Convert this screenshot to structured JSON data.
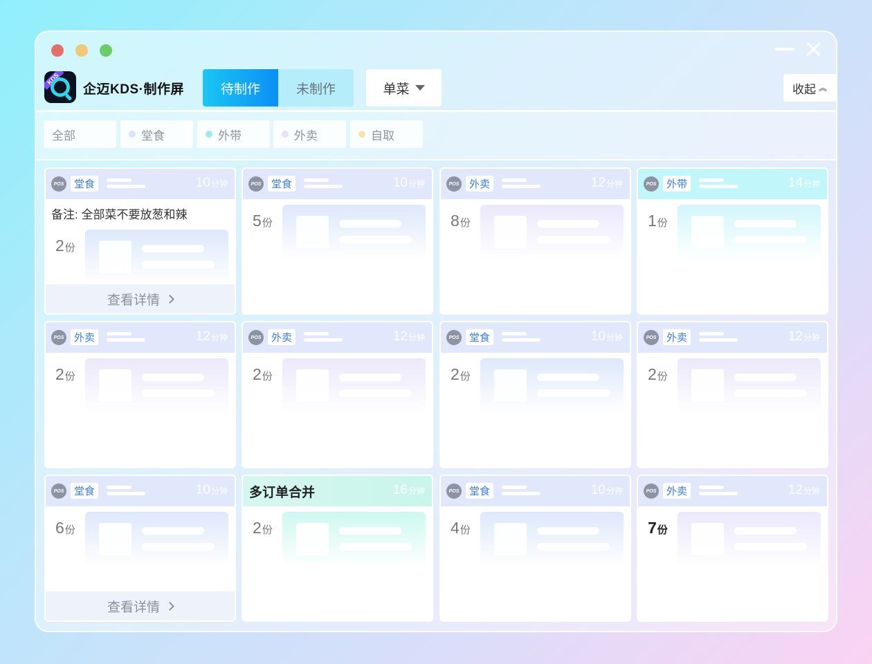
{
  "app": {
    "title": "企迈KDS·制作屏",
    "logo_badge": "KDS"
  },
  "tabs": {
    "active": "待制作",
    "inactive": "未制作"
  },
  "dish_select": {
    "value": "单菜"
  },
  "collapse_label": "收起",
  "filters": [
    {
      "label": "全部",
      "dot": null
    },
    {
      "label": "堂食",
      "dot": "#dbe3fb"
    },
    {
      "label": "外带",
      "dot": "#9ee8f3"
    },
    {
      "label": "外卖",
      "dot": "#e4e2fb"
    },
    {
      "label": "自取",
      "dot": "#fbe3a9"
    }
  ],
  "pos_label": "POS",
  "time_unit": "分钟",
  "qty_unit": "份",
  "detail_label": "查看详情",
  "note_prefix": "备注: ",
  "cards": [
    {
      "channel": "堂食",
      "minutes": "10",
      "qty": "2",
      "note": "全部菜不要放葱和辣",
      "detail": true,
      "theme": "blue"
    },
    {
      "channel": "堂食",
      "minutes": "10",
      "qty": "5",
      "theme": "blue"
    },
    {
      "channel": "外卖",
      "minutes": "12",
      "qty": "8",
      "theme": "lav"
    },
    {
      "channel": "外带",
      "minutes": "14",
      "qty": "1",
      "theme": "cyan"
    },
    {
      "channel": "外卖",
      "minutes": "12",
      "qty": "2",
      "theme": "lav"
    },
    {
      "channel": "外卖",
      "minutes": "12",
      "qty": "2",
      "theme": "lav"
    },
    {
      "channel": "堂食",
      "minutes": "10",
      "qty": "2",
      "theme": "blue"
    },
    {
      "channel": "外卖",
      "minutes": "12",
      "qty": "2",
      "theme": "lav"
    },
    {
      "channel": "堂食",
      "minutes": "10",
      "qty": "6",
      "detail": true,
      "theme": "blue"
    },
    {
      "merged_title": "多订单合并",
      "minutes": "16",
      "qty": "2",
      "theme": "mint"
    },
    {
      "channel": "堂食",
      "minutes": "10",
      "qty": "4",
      "theme": "blue"
    },
    {
      "channel": "外卖",
      "minutes": "12",
      "qty": "7",
      "qty_emphasis": true,
      "theme": "lav"
    }
  ]
}
